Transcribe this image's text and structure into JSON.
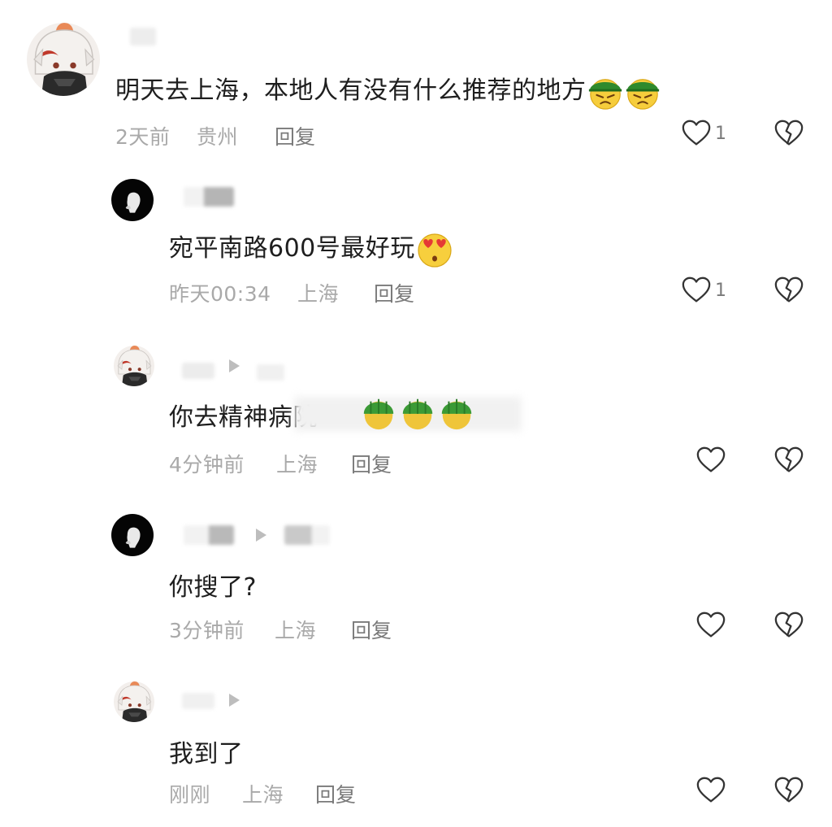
{
  "comments": [
    {
      "avatar": "anime-chibi-avatar",
      "text": "明天去上海，本地人有没有什么推荐的地方",
      "emoji": [
        "grumpy-green-hat-emoji",
        "grumpy-green-hat-emoji"
      ],
      "time": "2天前",
      "location": "贵州",
      "reply_label": "回复",
      "like_count": "1"
    },
    {
      "avatar": "dark-silhouette-avatar",
      "text": "宛平南路600号最好玩",
      "emoji": [
        "heart-eyes-emoji"
      ],
      "time": "昨天00:34",
      "location": "上海",
      "reply_label": "回复",
      "like_count": "1"
    },
    {
      "avatar": "anime-chibi-avatar",
      "text": "你去精神病院",
      "emoji": [
        "green-hat-emoji",
        "green-hat-emoji",
        "green-hat-emoji"
      ],
      "time": "4分钟前",
      "location": "上海",
      "reply_label": "回复",
      "like_count": ""
    },
    {
      "avatar": "dark-silhouette-avatar",
      "text": "你搜了?",
      "time": "3分钟前",
      "location": "上海",
      "reply_label": "回复",
      "like_count": ""
    },
    {
      "avatar": "anime-chibi-avatar",
      "text": "我到了",
      "time": "刚刚",
      "location": "上海",
      "reply_label": "回复",
      "like_count": ""
    }
  ],
  "icons": {
    "like": "heart-outline-icon",
    "dislike": "broken-heart-icon",
    "reply_arrow": "play-triangle-icon"
  },
  "colors": {
    "text": "#1e1e1e",
    "meta": "#a9a9a9",
    "reply": "#7a7a7a",
    "icon": "#333333"
  }
}
